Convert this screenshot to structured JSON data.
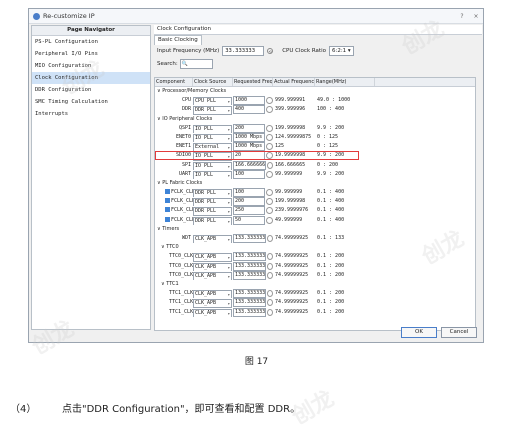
{
  "window": {
    "title": "Re-customize IP",
    "help": "?",
    "close": "×"
  },
  "left_panel": {
    "header": "Page Navigator",
    "items": [
      "PS-PL Configuration",
      "Peripheral I/O Pins",
      "MIO Configuration",
      "Clock Configuration",
      "DDR Configuration",
      "SMC Timing Calculation",
      "Interrupts"
    ],
    "selected_index": 3
  },
  "right_panel": {
    "header": "Clock Configuration",
    "tab": "Basic Clocking",
    "input_freq_label": "Input Frequency (MHz)",
    "input_freq_value": "33.333333",
    "cpu_ratio_label": "CPU Clock Ratio",
    "cpu_ratio_value": "6:2:1",
    "search_label": "Search:",
    "search_value": ""
  },
  "table": {
    "columns": [
      "Component",
      "Clock Source",
      "Requested Frequency (MHz)",
      "Actual Frequency (MHz)",
      "Range(MHz)"
    ],
    "rows": [
      {
        "type": "group",
        "indent": 0,
        "name": "Processor/Memory Clocks"
      },
      {
        "type": "row",
        "indent": 2,
        "name": "CPU",
        "source": "CPU PLL",
        "req": "1000",
        "actual": "999.999991",
        "range": "49.0 : 1000"
      },
      {
        "type": "row",
        "indent": 2,
        "name": "DDR",
        "source": "DDR PLL",
        "req": "400",
        "actual": "399.999996",
        "range": "100 : 400"
      },
      {
        "type": "group",
        "indent": 0,
        "name": "IO Peripheral Clocks"
      },
      {
        "type": "row",
        "indent": 2,
        "name": "QSPI",
        "source": "IO PLL",
        "req": "200",
        "actual": "199.999998",
        "range": "9.9 : 200"
      },
      {
        "type": "row",
        "indent": 2,
        "name": "ENET0",
        "source": "IO PLL",
        "req": "1000 Mbps",
        "actual": "124.99999875",
        "range": "0 : 125"
      },
      {
        "type": "row",
        "indent": 2,
        "name": "ENET1",
        "source": "External",
        "req": "1000 Mbps",
        "actual": "125",
        "range": "0 : 125"
      },
      {
        "type": "row",
        "indent": 2,
        "name": "SDIO0",
        "source": "IO PLL",
        "req": "20",
        "actual": "19.9999998",
        "range": "9.9 : 200",
        "highlight": true
      },
      {
        "type": "row",
        "indent": 2,
        "name": "SPI",
        "source": "IO PLL",
        "req": "166.666666",
        "actual": "166.666665",
        "range": "0 : 200"
      },
      {
        "type": "row",
        "indent": 2,
        "name": "UART",
        "source": "IO PLL",
        "req": "100",
        "actual": "99.999999",
        "range": "9.9 : 200"
      },
      {
        "type": "group",
        "indent": 0,
        "name": "PL Fabric Clocks"
      },
      {
        "type": "row",
        "indent": 2,
        "check": true,
        "name": "FCLK_CLK0",
        "source": "DDR PLL",
        "req": "100",
        "actual": "99.999999",
        "range": "0.1 : 400"
      },
      {
        "type": "row",
        "indent": 2,
        "check": true,
        "name": "FCLK_CLK1",
        "source": "DDR PLL",
        "req": "200",
        "actual": "199.999998",
        "range": "0.1 : 400"
      },
      {
        "type": "row",
        "indent": 2,
        "check": true,
        "name": "FCLK_CLK2",
        "source": "DDR PLL",
        "req": "250",
        "actual": "239.9999976",
        "range": "0.1 : 400"
      },
      {
        "type": "row",
        "indent": 2,
        "check": true,
        "name": "FCLK_CLK3",
        "source": "DDR PLL",
        "req": "50",
        "actual": "49.999999",
        "range": "0.1 : 400"
      },
      {
        "type": "group",
        "indent": 0,
        "name": "Timers"
      },
      {
        "type": "row",
        "indent": 2,
        "name": "WDT",
        "source": "CLK_APB",
        "req": "133.333333",
        "actual": "74.99999925",
        "range": "0.1 : 133"
      },
      {
        "type": "group",
        "indent": 1,
        "name": "TTC0"
      },
      {
        "type": "row",
        "indent": 3,
        "name": "TTC0_CLK0",
        "source": "CLK_APB",
        "req": "133.333333",
        "actual": "74.99999925",
        "range": "0.1 : 200"
      },
      {
        "type": "row",
        "indent": 3,
        "name": "TTC0_CLK1",
        "source": "CLK_APB",
        "req": "133.333333",
        "actual": "74.99999925",
        "range": "0.1 : 200"
      },
      {
        "type": "row",
        "indent": 3,
        "name": "TTC0_CLK2",
        "source": "CLK_APB",
        "req": "133.333333",
        "actual": "74.99999925",
        "range": "0.1 : 200"
      },
      {
        "type": "group",
        "indent": 1,
        "name": "TTC1"
      },
      {
        "type": "row",
        "indent": 3,
        "name": "TTC1_CLK0",
        "source": "CLK_APB",
        "req": "133.333333",
        "actual": "74.99999925",
        "range": "0.1 : 200"
      },
      {
        "type": "row",
        "indent": 3,
        "name": "TTC1_CLK1",
        "source": "CLK_APB",
        "req": "133.333333",
        "actual": "74.99999925",
        "range": "0.1 : 200"
      },
      {
        "type": "row",
        "indent": 3,
        "name": "TTC1_CLK2",
        "source": "CLK_APB",
        "req": "133.333333",
        "actual": "74.99999925",
        "range": "0.1 : 200"
      }
    ]
  },
  "buttons": {
    "ok": "OK",
    "cancel": "Cancel"
  },
  "caption": "图 17",
  "step": {
    "number": "（4）",
    "text": "点击\"DDR Configuration\"，即可查看和配置 DDR。"
  },
  "colors": {
    "highlight": "#e23b3b",
    "selected": "#cfe2f7",
    "checkbox": "#3d83d6"
  }
}
